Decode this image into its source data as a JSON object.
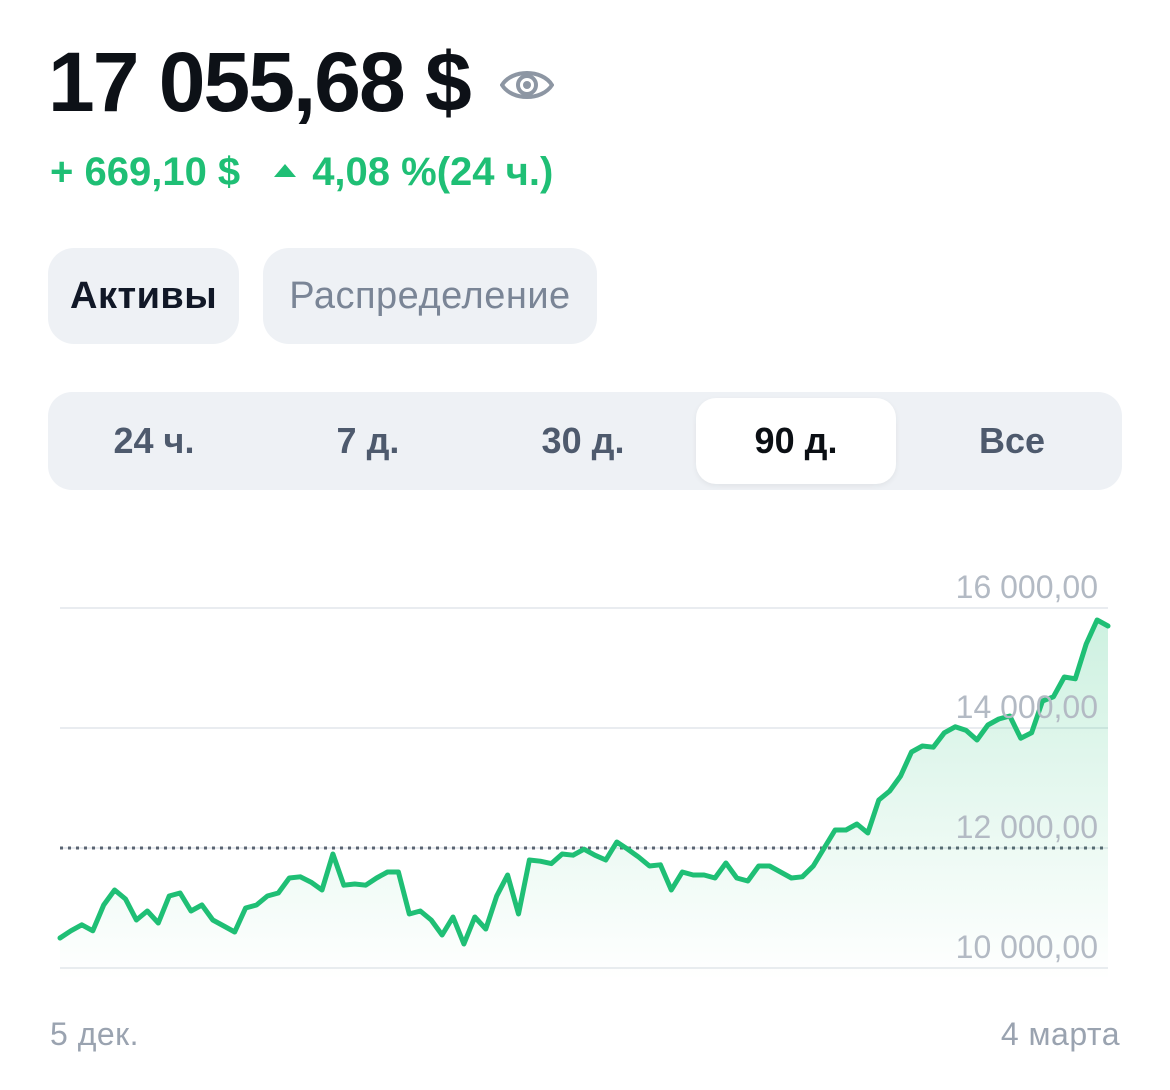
{
  "balance": {
    "value": "17 055,68 $"
  },
  "change": {
    "amount": "+ 669,10 $",
    "percent": "4,08 %",
    "period": "(24 ч.)"
  },
  "view_tabs": [
    {
      "label": "Активы",
      "active": true
    },
    {
      "label": "Распределение",
      "active": false
    }
  ],
  "ranges": [
    {
      "label": "24 ч.",
      "active": false
    },
    {
      "label": "7 д.",
      "active": false
    },
    {
      "label": "30 д.",
      "active": false
    },
    {
      "label": "90 д.",
      "active": true
    },
    {
      "label": "Все",
      "active": false
    }
  ],
  "colors": {
    "accent": "#1fbf75",
    "text": "#0d1117",
    "muted": "#9aa3b0",
    "tab_bg": "#eef1f5"
  },
  "icons": {
    "visibility": "eye-icon",
    "up": "triangle-up-icon"
  },
  "dates": {
    "start": "5 дек.",
    "end": "4 марта"
  },
  "chart_data": {
    "type": "area",
    "yticks": [
      "16 000,00",
      "14 000,00",
      "12 000,00",
      "10 000,00"
    ],
    "ytick_values": [
      16000,
      14000,
      12000,
      10000
    ],
    "ylim": [
      9800,
      16800
    ],
    "reference_line": 12000,
    "values": [
      10500,
      10620,
      10720,
      10620,
      11050,
      11300,
      11150,
      10800,
      10950,
      10750,
      11200,
      11250,
      10950,
      11050,
      10800,
      10700,
      10600,
      11000,
      11050,
      11200,
      11250,
      11500,
      11520,
      11430,
      11300,
      11900,
      11380,
      11400,
      11380,
      11500,
      11600,
      11600,
      10900,
      10950,
      10800,
      10550,
      10850,
      10400,
      10850,
      10650,
      11200,
      11550,
      10900,
      11800,
      11780,
      11740,
      11900,
      11880,
      11980,
      11880,
      11800,
      12100,
      11980,
      11850,
      11700,
      11720,
      11300,
      11600,
      11550,
      11550,
      11500,
      11750,
      11500,
      11450,
      11700,
      11700,
      11600,
      11500,
      11520,
      11700,
      12000,
      12300,
      12300,
      12400,
      12250,
      12800,
      12950,
      13200,
      13600,
      13700,
      13680,
      13920,
      14020,
      13960,
      13800,
      14050,
      14150,
      14200,
      13830,
      13920,
      14450,
      14520,
      14850,
      14820,
      15400,
      15800,
      15700
    ]
  }
}
